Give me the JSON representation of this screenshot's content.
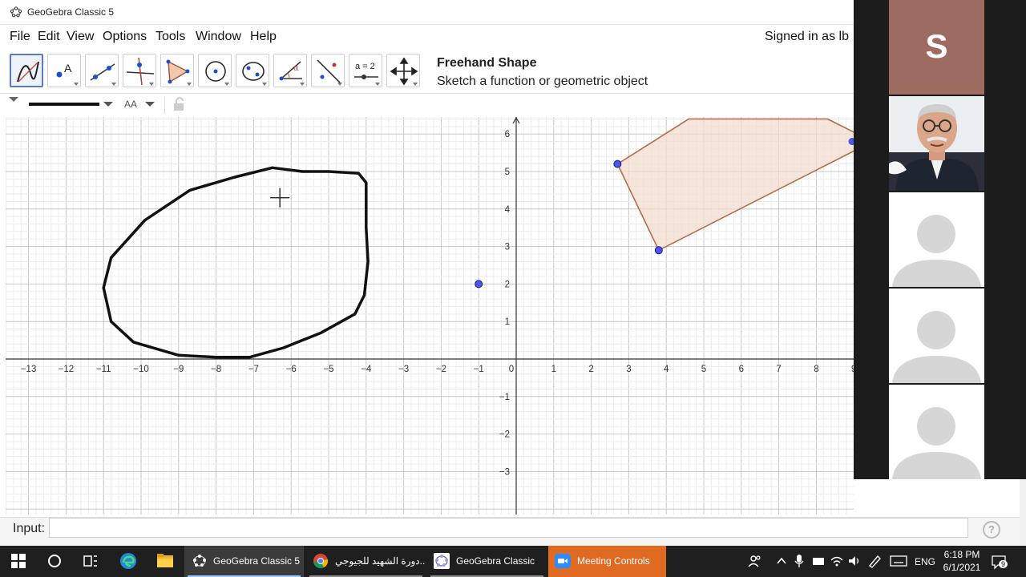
{
  "window": {
    "title": "GeoGebra Classic 5"
  },
  "menubar": {
    "items": [
      "File",
      "Edit",
      "View",
      "Options",
      "Tools",
      "Window",
      "Help"
    ],
    "signed_in": "Signed in as lb"
  },
  "toolbar": {
    "tools": [
      "freehand-shape",
      "point-text",
      "line",
      "perpendicular-line",
      "polygon",
      "circle",
      "conic",
      "angle",
      "reflect",
      "slider",
      "move-graphics-view"
    ],
    "slider_label": "a = 2",
    "tool_title": "Freehand Shape",
    "tool_description": "Sketch a function or geometric object"
  },
  "stylebar": {
    "text_size_label": "AA"
  },
  "graphics": {
    "x_ticks": [
      "−13",
      "−12",
      "−11",
      "−10",
      "−9",
      "−8",
      "−7",
      "−6",
      "−5",
      "−4",
      "−3",
      "−2",
      "−1",
      "0",
      "1",
      "2",
      "3",
      "4",
      "5",
      "6",
      "7",
      "8",
      "9"
    ],
    "y_ticks": [
      "6",
      "5",
      "4",
      "3",
      "2",
      "1",
      "−1",
      "−2",
      "−3"
    ],
    "point": {
      "x": -1,
      "y": 2
    },
    "polygon_vertices": [
      [
        2.7,
        5.2
      ],
      [
        3.8,
        2.9
      ]
    ],
    "colors": {
      "polygon_fill": "#f3dccf",
      "polygon_stroke": "#b36d4a",
      "point": "#4b55e8",
      "stroke": "#111111"
    }
  },
  "input_bar": {
    "label": "Input:",
    "value": "",
    "help": "?"
  },
  "zoom": {
    "presenter_initial": "S",
    "tile_colors": {
      "initial_bg": "#9e6b63"
    }
  },
  "taskbar": {
    "apps": [
      {
        "label": "GeoGebra Classic 5"
      },
      {
        "label": "دورة الشهيد للجيوجي..."
      },
      {
        "label": "GeoGebra Classic"
      },
      {
        "label": "Meeting Controls"
      }
    ],
    "language": "ENG",
    "time": "6:18 PM",
    "date": "6/1/2021",
    "notification_count": "9"
  }
}
